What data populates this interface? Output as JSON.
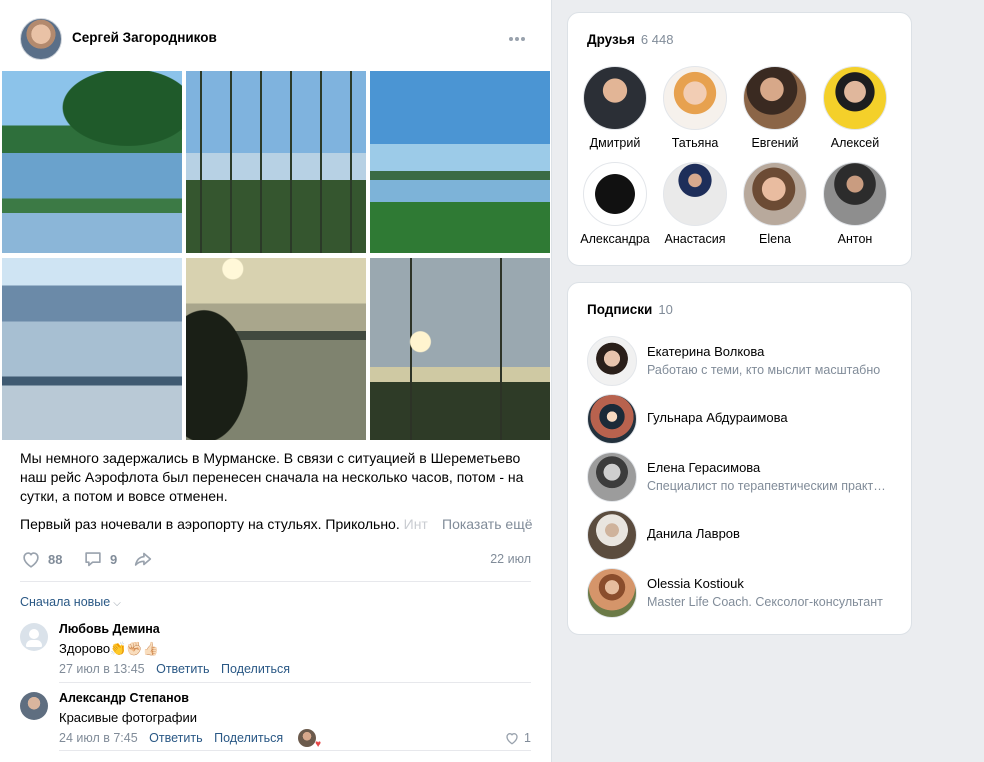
{
  "post": {
    "author": "Сергей Загородников",
    "text_p1": "Мы немного задержались в Мурманске. В связи с ситуацией в Шереметьево наш рейс Аэрофлота был перенесен сначала на несколько часов, потом - на сутки, а потом и вовсе отменен.",
    "text_p2_visible": "Первый раз ночевали в аэропорту на стульях. Прикольно. ",
    "text_p2_fade": "Инт",
    "show_more": "Показать ещё",
    "likes": "88",
    "comments": "9",
    "date": "22 июл",
    "sort_label": "Сначала новые"
  },
  "comments": [
    {
      "name": "Любовь Демина",
      "text": "Здорово👏✊🏻👍🏻",
      "date": "27 июл в 13:45",
      "reply": "Ответить",
      "share": "Поделиться"
    },
    {
      "name": "Александр Степанов",
      "text": "Красивые фотографии",
      "date": "24 июл в 7:45",
      "reply": "Ответить",
      "share": "Поделиться",
      "likes": "1"
    }
  ],
  "friends": {
    "title": "Друзья",
    "count": "6 448",
    "items": [
      {
        "name": "Дмитрий"
      },
      {
        "name": "Татьяна"
      },
      {
        "name": "Евгений"
      },
      {
        "name": "Алексей"
      },
      {
        "name": "Александра"
      },
      {
        "name": "Анастасия"
      },
      {
        "name": "Elena"
      },
      {
        "name": "Антон"
      }
    ]
  },
  "subscriptions": {
    "title": "Подписки",
    "count": "10",
    "items": [
      {
        "name": "Екатерина Волкова",
        "desc": "Работаю с теми, кто мыслит масштабно"
      },
      {
        "name": "Гульнара Абдураимова",
        "desc": ""
      },
      {
        "name": "Елена Герасимова",
        "desc": "Специалист по терапевтическим практикам"
      },
      {
        "name": "Данила Лавров",
        "desc": ""
      },
      {
        "name": "Olessia Kostiouk",
        "desc": "Master Life Coach. Сексолог-консультант"
      }
    ]
  },
  "colors": {
    "link": "#2a5885",
    "muted": "#818c99",
    "background": "#ebedf0"
  }
}
